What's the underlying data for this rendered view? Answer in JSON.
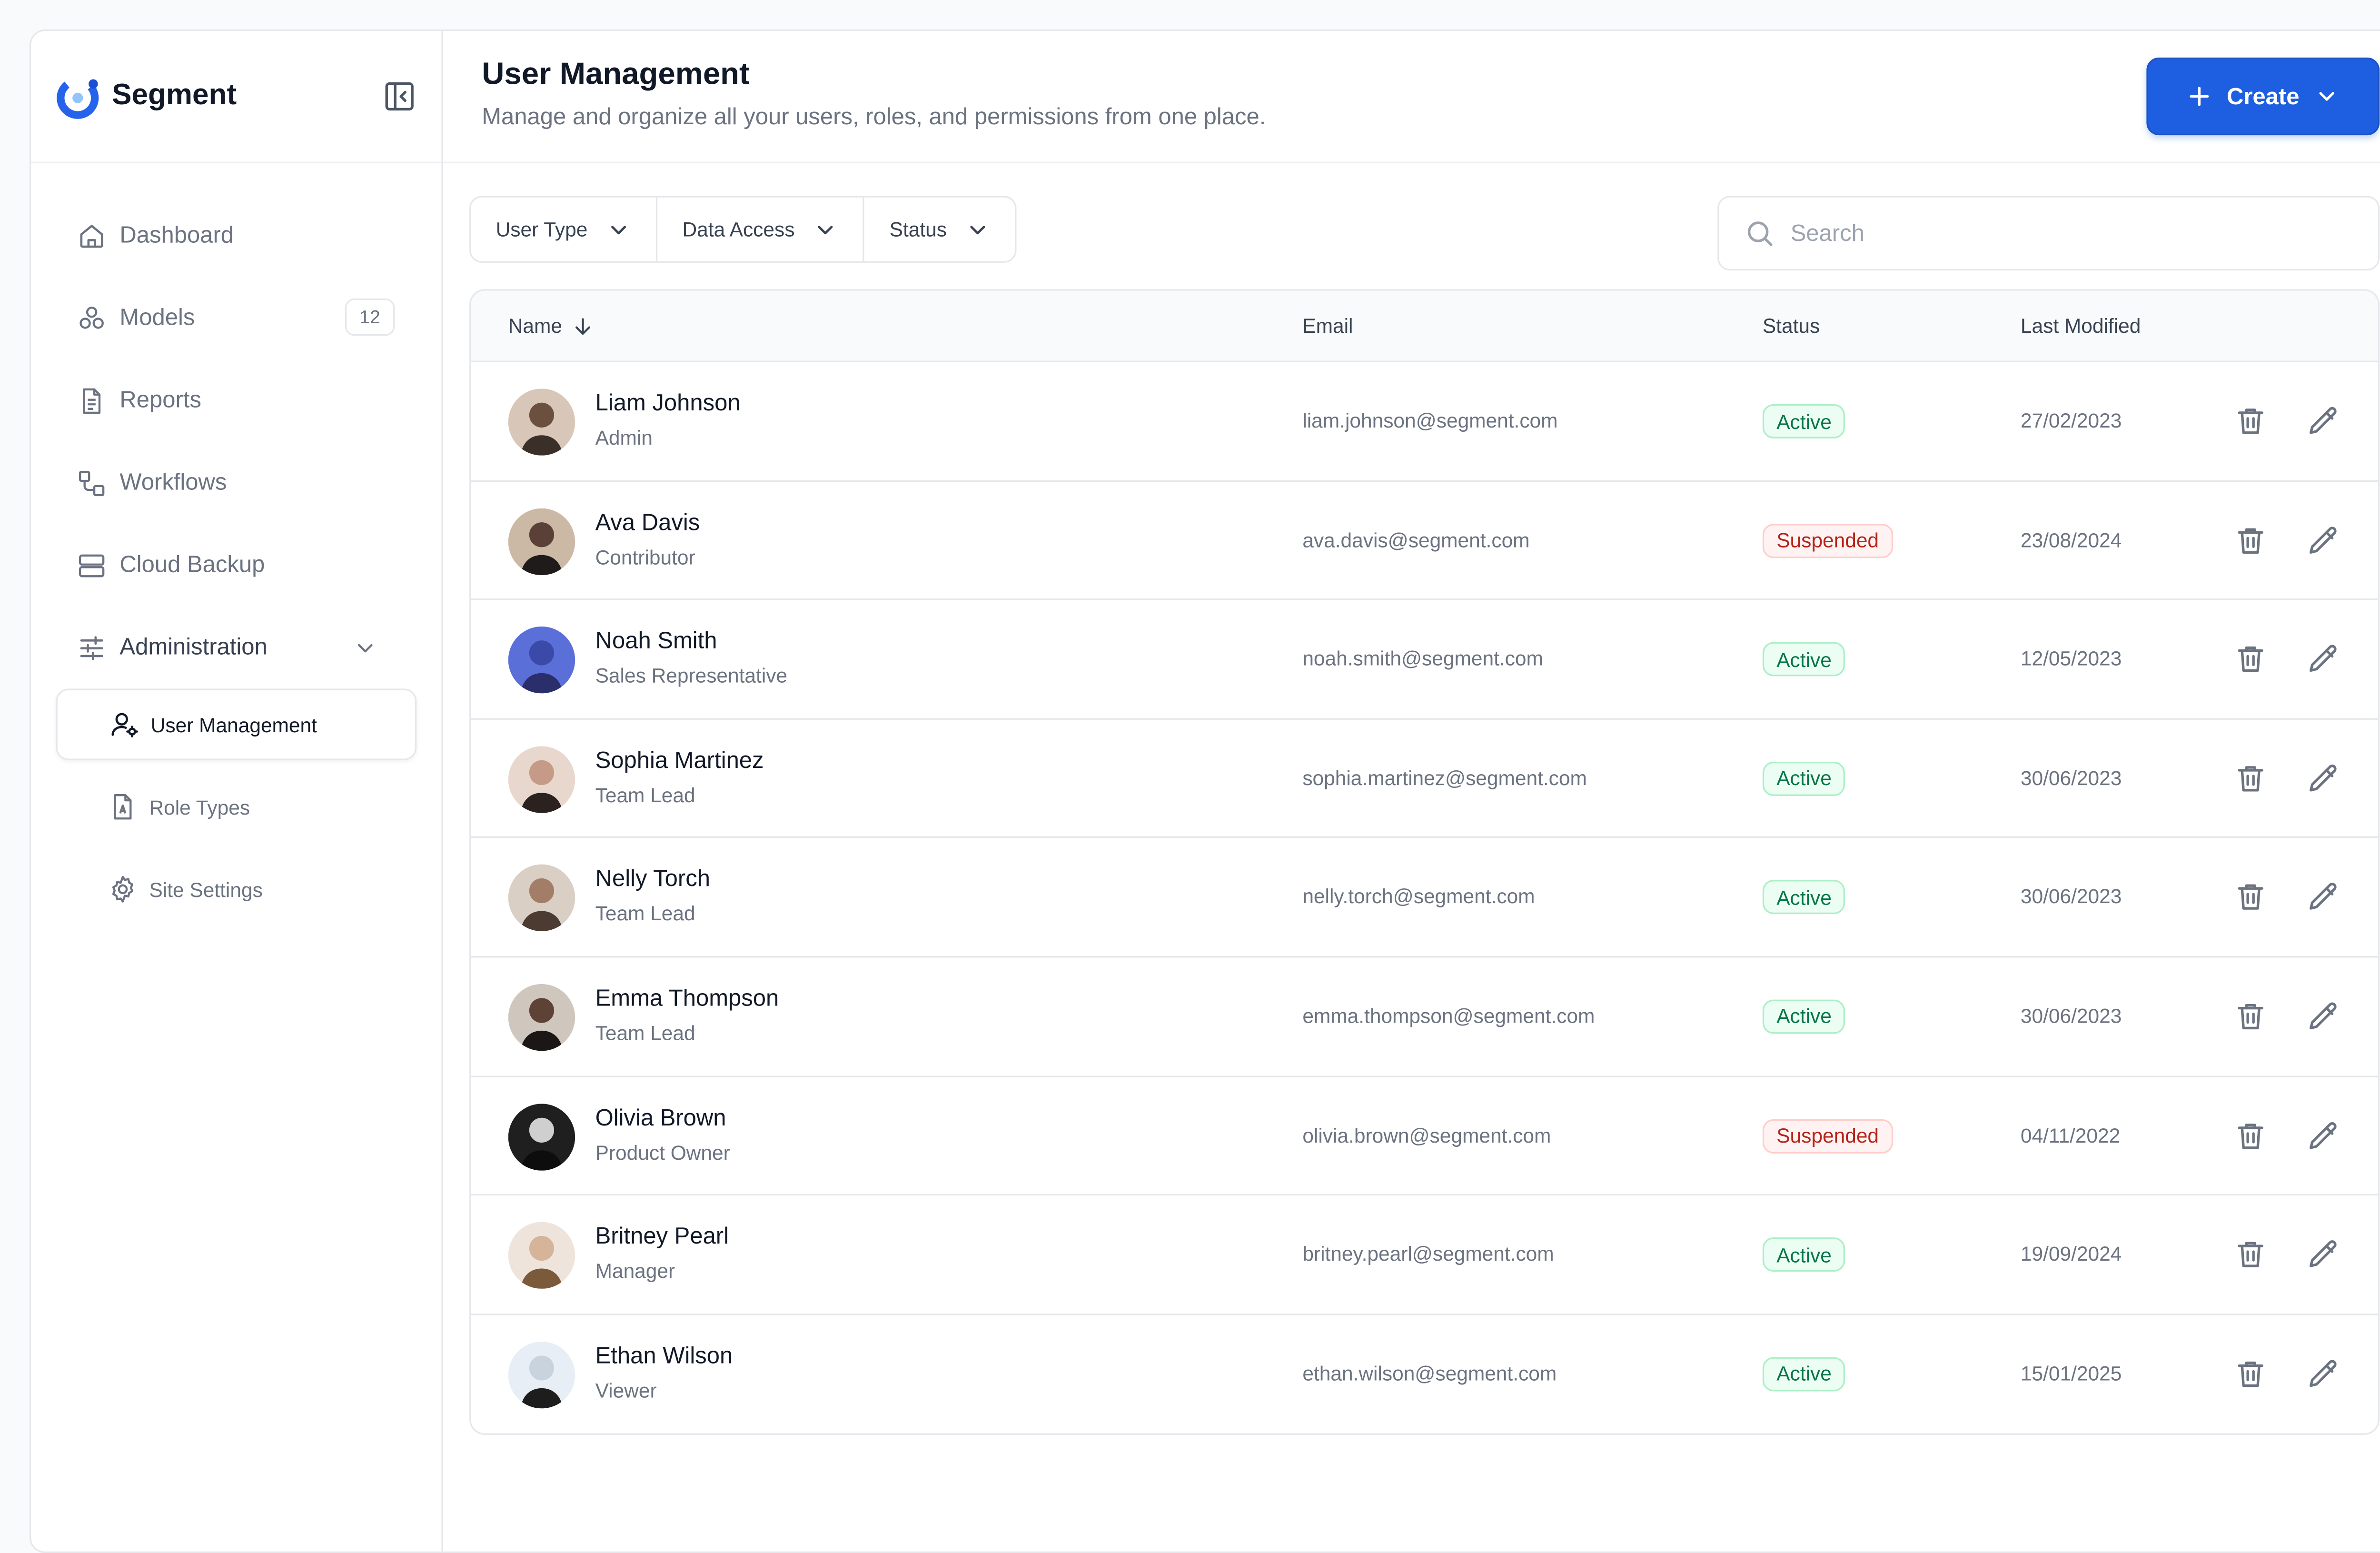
{
  "brand": {
    "name": "Segment",
    "accent": "#1d5fe0"
  },
  "sidebar": {
    "items": [
      {
        "label": "Dashboard",
        "icon": "home-icon"
      },
      {
        "label": "Models",
        "icon": "models-icon",
        "count": "12"
      },
      {
        "label": "Reports",
        "icon": "document-icon"
      },
      {
        "label": "Workflows",
        "icon": "workflow-icon"
      },
      {
        "label": "Cloud Backup",
        "icon": "server-icon"
      }
    ],
    "group": {
      "label": "Administration",
      "icon": "sliders-icon",
      "children": [
        {
          "label": "User Management",
          "icon": "user-settings-icon",
          "active": true
        },
        {
          "label": "Role Types",
          "icon": "role-document-icon"
        },
        {
          "label": "Site Settings",
          "icon": "gear-icon"
        }
      ]
    }
  },
  "header": {
    "title": "User Management",
    "subtitle": "Manage and organize all your users, roles, and permissions from one place.",
    "create_label": "Create"
  },
  "filters": [
    "User Type",
    "Data Access",
    "Status"
  ],
  "search": {
    "placeholder": "Search"
  },
  "table": {
    "columns": {
      "name": "Name",
      "email": "Email",
      "status": "Status",
      "modified": "Last Modified"
    },
    "rows": [
      {
        "name": "Liam Johnson",
        "role": "Admin",
        "email": "liam.johnson@segment.com",
        "status": "Active",
        "date": "27/02/2023"
      },
      {
        "name": "Ava Davis",
        "role": "Contributor",
        "email": "ava.davis@segment.com",
        "status": "Suspended",
        "date": "23/08/2024"
      },
      {
        "name": "Noah Smith",
        "role": "Sales Representative",
        "email": "noah.smith@segment.com",
        "status": "Active",
        "date": "12/05/2023"
      },
      {
        "name": "Sophia Martinez",
        "role": "Team Lead",
        "email": "sophia.martinez@segment.com",
        "status": "Active",
        "date": "30/06/2023"
      },
      {
        "name": "Nelly Torch",
        "role": "Team Lead",
        "email": "nelly.torch@segment.com",
        "status": "Active",
        "date": "30/06/2023"
      },
      {
        "name": "Emma Thompson",
        "role": "Team Lead",
        "email": "emma.thompson@segment.com",
        "status": "Active",
        "date": "30/06/2023"
      },
      {
        "name": "Olivia Brown",
        "role": "Product Owner",
        "email": "olivia.brown@segment.com",
        "status": "Suspended",
        "date": "04/11/2022"
      },
      {
        "name": "Britney Pearl",
        "role": "Manager",
        "email": "britney.pearl@segment.com",
        "status": "Active",
        "date": "19/09/2024"
      },
      {
        "name": "Ethan Wilson",
        "role": "Viewer",
        "email": "ethan.wilson@segment.com",
        "status": "Active",
        "date": "15/01/2025"
      }
    ]
  }
}
